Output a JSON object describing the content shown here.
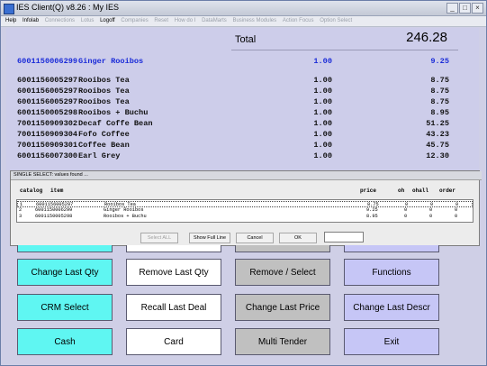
{
  "window": {
    "title": "IES Client(Q) v8.26 : My IES"
  },
  "menu": [
    {
      "label": "Help",
      "enabled": true
    },
    {
      "label": "Infolab",
      "enabled": true
    },
    {
      "label": "Connections",
      "enabled": false
    },
    {
      "label": "Lotus",
      "enabled": false
    },
    {
      "label": "Logoff",
      "enabled": true
    },
    {
      "label": "Companies",
      "enabled": false
    },
    {
      "label": "Reset",
      "enabled": false
    },
    {
      "label": "How do I",
      "enabled": false
    },
    {
      "label": "DataMarts",
      "enabled": false
    },
    {
      "label": "Business Modules",
      "enabled": false
    },
    {
      "label": "Action Focus",
      "enabled": false
    },
    {
      "label": "Option Select",
      "enabled": false
    }
  ],
  "total": {
    "label": "Total",
    "value": "246.28"
  },
  "lines": [
    {
      "code": "6001150006299",
      "desc": "Ginger Rooibos",
      "qty": "1.00",
      "price": "9.25",
      "highlight": true
    },
    {
      "code": "6001156005297",
      "desc": "Rooibos Tea",
      "qty": "1.00",
      "price": "8.75"
    },
    {
      "code": "6001156005297",
      "desc": "Rooibos Tea",
      "qty": "1.00",
      "price": "8.75"
    },
    {
      "code": "6001156005297",
      "desc": "Rooibos Tea",
      "qty": "1.00",
      "price": "8.75"
    },
    {
      "code": "6001150005298",
      "desc": "Rooibos + Buchu",
      "qty": "1.00",
      "price": "8.95"
    },
    {
      "code": "7001150909302",
      "desc": "Decaf Coffe Bean",
      "qty": "1.00",
      "price": "51.25"
    },
    {
      "code": "7001150909304",
      "desc": "Fofo Coffee",
      "qty": "1.00",
      "price": "43.23"
    },
    {
      "code": "7001150909301",
      "desc": "Coffee Bean",
      "qty": "1.00",
      "price": "45.75"
    },
    {
      "code": "6001156007300",
      "desc": "Earl Grey",
      "qty": "1.00",
      "price": "12.30"
    }
  ],
  "dialog": {
    "title": "SINGLE SELECT: values found ...",
    "headers": {
      "catalog": "catalog",
      "item": "item",
      "price": "price",
      "oh": "oh",
      "ohall": "ohall",
      "order": "order"
    },
    "rows": [
      {
        "n": "1",
        "code": "6001156005297",
        "desc": "Rooibos Tea",
        "price": "8.75",
        "oh": "0",
        "ohall": "0",
        "order": "0"
      },
      {
        "n": "2",
        "code": "6001150006299",
        "desc": "Ginger Rooibos",
        "price": "9.25",
        "oh": "0",
        "ohall": "0",
        "order": "0"
      },
      {
        "n": "3",
        "code": "6001150005298",
        "desc": "Rooibos + Buchu",
        "price": "8.95",
        "oh": "0",
        "ohall": "0",
        "order": "0"
      }
    ],
    "buttons": {
      "select_all": "Select ALL",
      "show_full_line": "Show Full Line",
      "cancel": "Cancel",
      "ok": "OK"
    }
  },
  "buttons": {
    "change_last_qty": "Change Last Qty",
    "remove_last_qty": "Remove Last Qty",
    "remove_select": "Remove / Select",
    "functions": "Functions",
    "crm_select": "CRM Select",
    "recall_last_deal": "Recall Last Deal",
    "change_last_price": "Change Last Price",
    "change_last_descr": "Change Last Descr",
    "cash": "Cash",
    "card": "Card",
    "multi_tender": "Multi Tender",
    "exit": "Exit"
  }
}
